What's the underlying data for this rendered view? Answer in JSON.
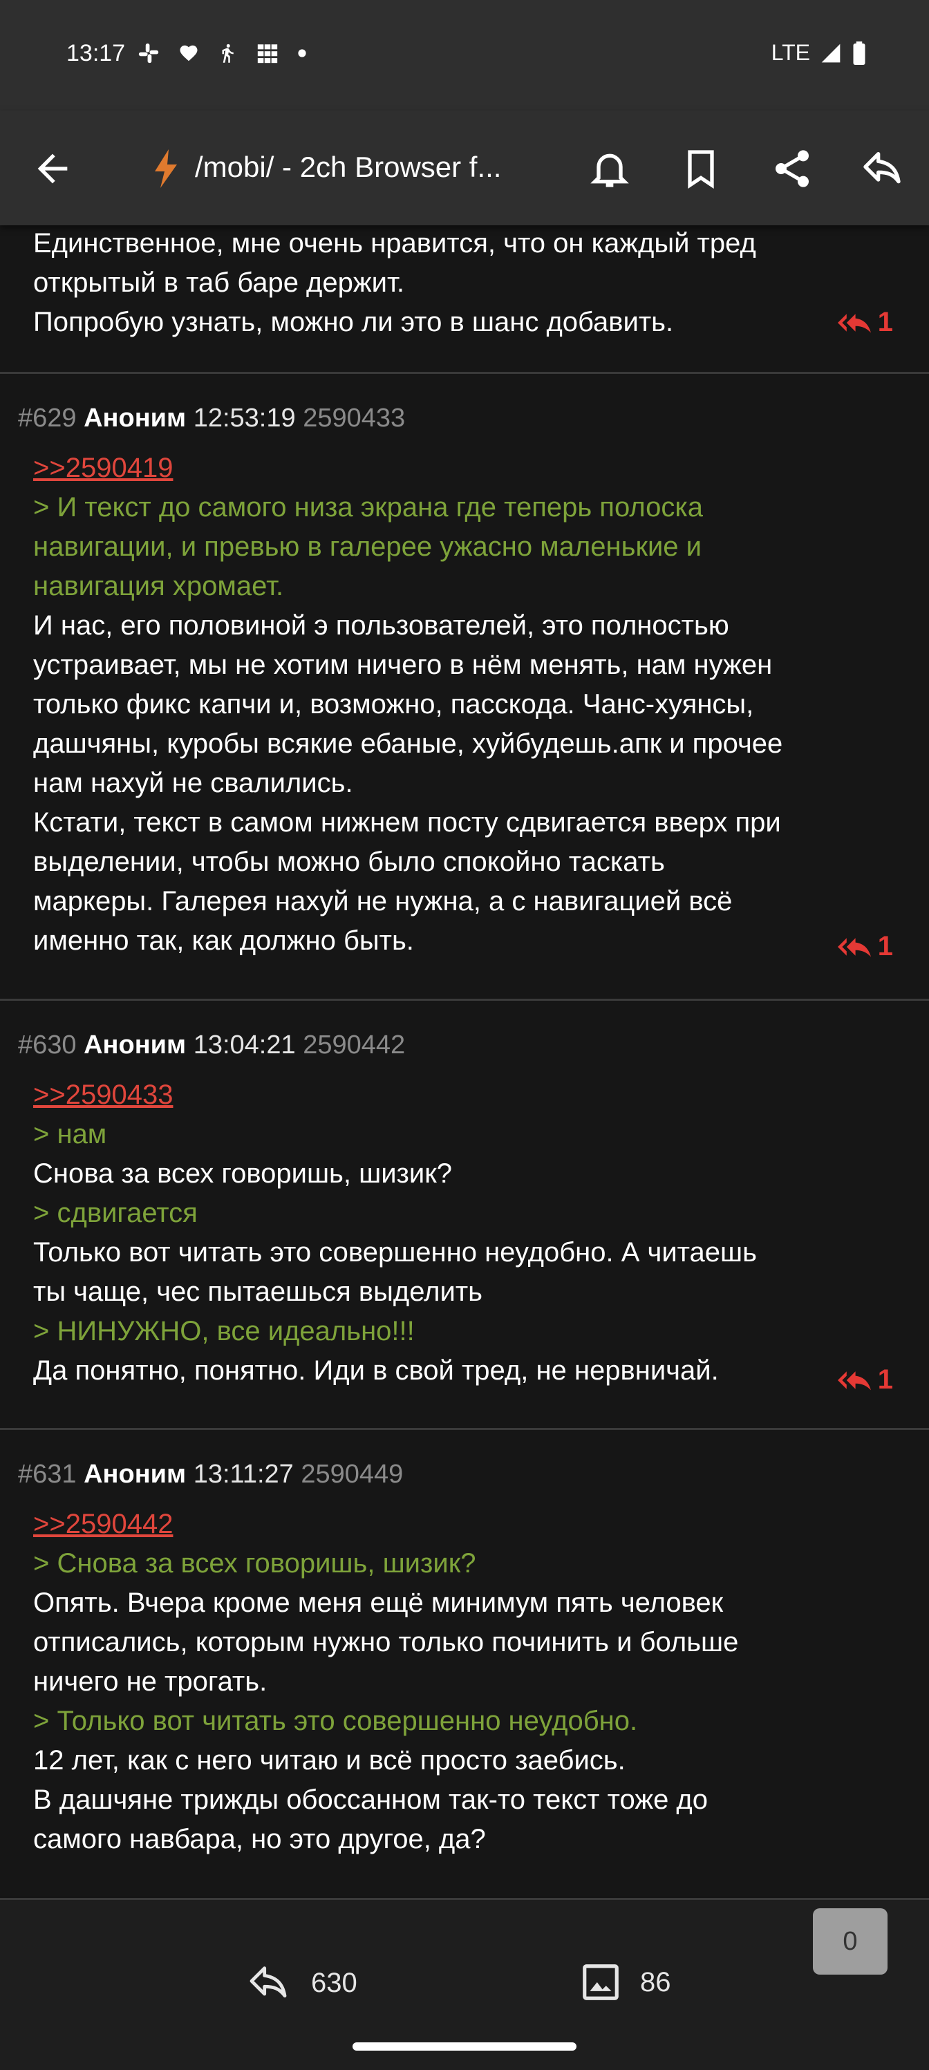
{
  "status_bar": {
    "time": "13:17",
    "network": "LTE"
  },
  "app_bar": {
    "title": "/mobi/ - 2ch Browser f..."
  },
  "posts": [
    {
      "lines": [
        {
          "type": "text",
          "text": "Единственное, мне очень нравится, что он каждый тред"
        },
        {
          "type": "text",
          "text": "открытый в таб баре держит."
        },
        {
          "type": "text",
          "text": "Попробую узнать, можно ли это в шанс добавить."
        }
      ],
      "replies": "1"
    },
    {
      "num": "#629",
      "author": "Аноним",
      "time": "12:53:19",
      "id": "2590433",
      "lines": [
        {
          "type": "link",
          "text": ">>2590419"
        },
        {
          "type": "quote",
          "text": "> И текст до самого низа экрана где теперь полоска"
        },
        {
          "type": "quote",
          "text": "навигации, и превью в галерее ужасно маленькие и"
        },
        {
          "type": "quote",
          "text": "навигация хромает."
        },
        {
          "type": "text",
          "text": "И нас, его половиной э пользователей, это полностью"
        },
        {
          "type": "text",
          "text": "устраивает, мы не хотим ничего в нём менять, нам нужен"
        },
        {
          "type": "text",
          "text": "только фикс капчи и, возможно, пасскода. Чанс-хуянсы,"
        },
        {
          "type": "text",
          "text": "дашчяны, куробы всякие ебаные, хуйбудешь.апк и прочее"
        },
        {
          "type": "text",
          "text": "нам нахуй не свалились."
        },
        {
          "type": "text",
          "text": "Кстати, текст в самом нижнем посту сдвигается вверх при"
        },
        {
          "type": "text",
          "text": "выделении, чтобы можно было спокойно таскать"
        },
        {
          "type": "text",
          "text": "маркеры. Галерея нахуй не нужна, а с навигацией всё"
        },
        {
          "type": "text",
          "text": "именно так, как должно быть."
        }
      ],
      "replies": "1"
    },
    {
      "num": "#630",
      "author": "Аноним",
      "time": "13:04:21",
      "id": "2590442",
      "lines": [
        {
          "type": "link",
          "text": ">>2590433"
        },
        {
          "type": "quote",
          "text": "> нам"
        },
        {
          "type": "text",
          "text": "Снова за всех говоришь, шизик?"
        },
        {
          "type": "quote",
          "text": "> сдвигается"
        },
        {
          "type": "text",
          "text": "Только вот читать это совершенно неудобно. А читаешь"
        },
        {
          "type": "text",
          "text": "ты чаще, чес пытаешься выделить"
        },
        {
          "type": "quote",
          "text": "> НИНУЖНО, все идеально!!!"
        },
        {
          "type": "text",
          "text": "Да понятно, понятно. Иди в свой тред, не нервничай."
        }
      ],
      "replies": "1"
    },
    {
      "num": "#631",
      "author": "Аноним",
      "time": "13:11:27",
      "id": "2590449",
      "lines": [
        {
          "type": "link",
          "text": ">>2590442"
        },
        {
          "type": "quote",
          "text": "> Снова за всех говоришь, шизик?"
        },
        {
          "type": "text",
          "text": "Опять. Вчера кроме меня ещё минимум пять человек"
        },
        {
          "type": "text",
          "text": "отписались, которым нужно только починить и больше"
        },
        {
          "type": "text",
          "text": "ничего не трогать."
        },
        {
          "type": "quote",
          "text": "> Только вот читать это совершенно неудобно."
        },
        {
          "type": "text",
          "text": "12 лет, как с него читаю и всё просто заебись."
        },
        {
          "type": "text",
          "text": "В дашчяне трижды обоссанном так-то текст тоже до"
        },
        {
          "type": "text",
          "text": "самого навбара, но это другое, да?"
        }
      ],
      "replies": null
    }
  ],
  "bottom_bar": {
    "posts_count": "630",
    "images_count": "86",
    "unread": "0"
  },
  "colors": {
    "link": "#e0463c",
    "quote": "#7ea33a",
    "reply_badge": "#e53935"
  }
}
